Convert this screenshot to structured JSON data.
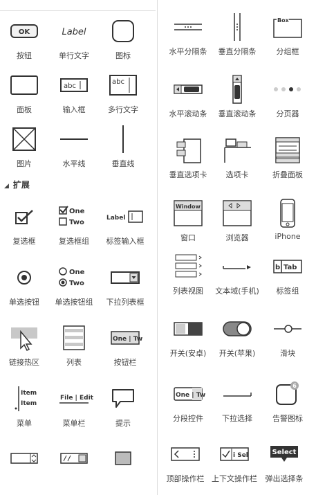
{
  "section": {
    "expand_label": "扩展"
  },
  "left": {
    "button": "按钮",
    "label_text": "单行文字",
    "icon": "图标",
    "panel": "面板",
    "input": "输入框",
    "textarea": "多行文字",
    "image": "图片",
    "hline": "水平线",
    "vline": "垂直线",
    "checkbox": "复选框",
    "checkbox_group": "复选框组",
    "label_input": "标签输入框",
    "radio": "单选按钮",
    "radio_group": "单选按钮组",
    "dropdown": "下拉列表框",
    "hotspot": "链接热区",
    "list": "列表",
    "button_bar": "按钮栏",
    "menu": "菜单",
    "menubar": "菜单栏",
    "tooltip": "提示"
  },
  "right": {
    "h_separator": "水平分隔条",
    "v_separator": "垂直分隔条",
    "groupbox": "分组框",
    "h_scroll": "水平滚动条",
    "v_scroll": "垂直滚动条",
    "pager": "分页器",
    "v_tabs": "垂直选项卡",
    "tabs": "选项卡",
    "accordion": "折叠面板",
    "window": "窗口",
    "browser": "浏览器",
    "iphone": "iPhone",
    "listview": "列表视图",
    "textfield_mobile": "文本域(手机)",
    "tabgroup": "标签组",
    "switch_android": "开关(安卓)",
    "switch_apple": "开关(苹果)",
    "slider": "滑块",
    "segmented": "分段控件",
    "dropdown_select": "下拉选择",
    "alert_badge": "告警图标",
    "top_actionbar": "顶部操作栏",
    "context_actionbar": "上下文操作栏",
    "popup_select": "弹出选择条"
  },
  "icon_text": {
    "ok": "OK",
    "label": "Label",
    "abc": "abc",
    "box": "Box",
    "one": "One",
    "two": "Two",
    "label_small": "Label",
    "tab": "Tab",
    "window": "Window",
    "item": "Item",
    "file_edit": "File | Edit",
    "one_tw": "One | Tw",
    "badge": "6",
    "select": "Select",
    "i_sel": "i Sel"
  },
  "colors": {
    "stroke": "#333333",
    "switch_dark": "#444444",
    "divider": "#dddddd",
    "hotspot": "#c8c8c8"
  }
}
